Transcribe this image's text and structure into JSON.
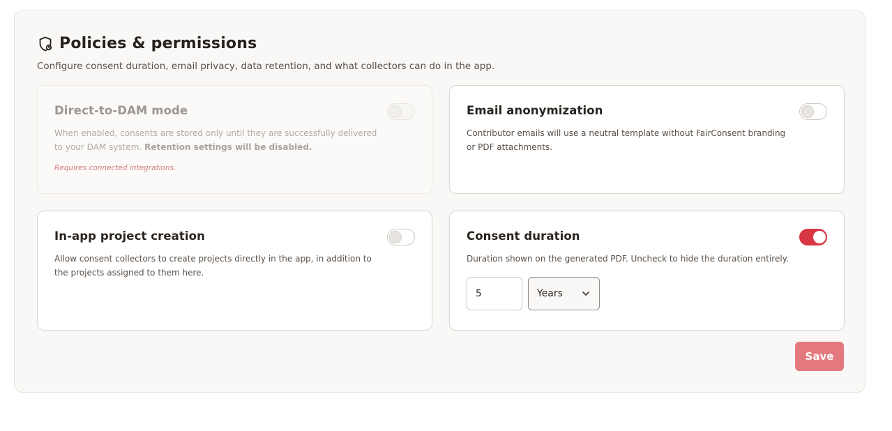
{
  "header": {
    "title": "Policies & permissions",
    "subtitle": "Configure consent duration, email privacy, data retention, and what collectors can do in the app.",
    "icon": "shield-icon"
  },
  "cards": {
    "direct_to_dam": {
      "title": "Direct-to-DAM mode",
      "desc_main": "When enabled, consents are stored only until they are successfully delivered to your DAM system.",
      "desc_bold": "Retention settings will be disabled.",
      "note": "Requires connected integrations.",
      "enabled": false,
      "disabled": true
    },
    "email_anonymization": {
      "title": "Email anonymization",
      "desc": "Contributor emails will use a neutral template without FairConsent branding or PDF attachments.",
      "enabled": false
    },
    "in_app_project": {
      "title": "In-app project creation",
      "desc": "Allow consent collectors to create projects directly in the app, in addition to the projects assigned to them here.",
      "enabled": false
    },
    "consent_duration": {
      "title": "Consent duration",
      "desc": "Duration shown on the generated PDF. Uncheck to hide the duration entirely.",
      "enabled": true,
      "value": "5",
      "unit": "Years"
    }
  },
  "actions": {
    "save_label": "Save"
  },
  "colors": {
    "accent": "#d93644",
    "save_button": "#e3787e",
    "panel_bg": "#f9f8f6"
  }
}
